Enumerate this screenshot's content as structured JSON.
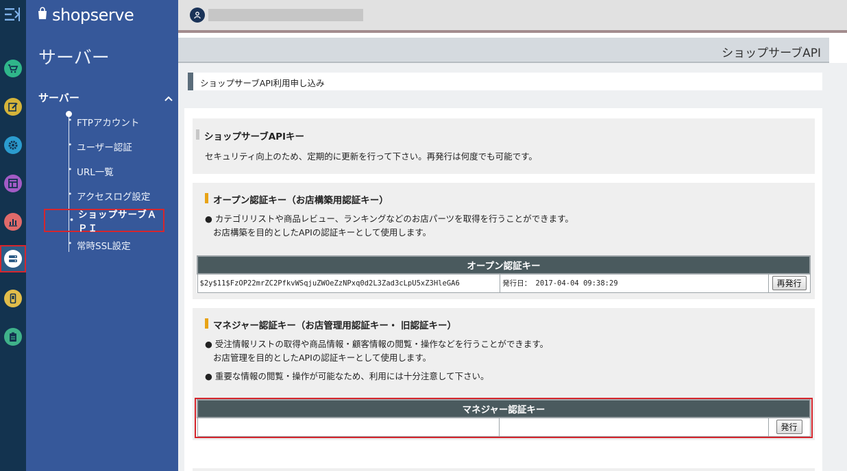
{
  "brand": {
    "name": "shopserve"
  },
  "rail": {
    "items": [
      {
        "name": "cart-icon",
        "color": "#2fb68a"
      },
      {
        "name": "edit-icon",
        "color": "#d5b43a"
      },
      {
        "name": "settings-icon",
        "color": "#2b9ccf"
      },
      {
        "name": "layout-icon",
        "color": "#a35bc6"
      },
      {
        "name": "chart-icon",
        "color": "#e06a6a"
      },
      {
        "name": "server-icon",
        "color": "#ffffff",
        "active": true
      },
      {
        "name": "mobile-icon",
        "color": "#e2bd4a"
      },
      {
        "name": "clipboard-icon",
        "color": "#3fb28a"
      }
    ]
  },
  "sidebar": {
    "title": "サーバー",
    "section": "サーバー",
    "items": [
      {
        "label": "FTPアカウント"
      },
      {
        "label": "ユーザー認証"
      },
      {
        "label": "URL一覧"
      },
      {
        "label": "アクセスログ設定"
      },
      {
        "label": "ショップサーブＡＰＩ",
        "active": true
      },
      {
        "label": "常時SSL設定"
      }
    ]
  },
  "header": {
    "user_name": ""
  },
  "page": {
    "title": "ショップサーブAPI",
    "breadcrumb": "ショップサーブAPI利用申し込み"
  },
  "api_key_panel": {
    "heading": "ショップサーブAPIキー",
    "description": "セキュリティ向上のため、定期的に更新を行って下さい。再発行は何度でも可能です。"
  },
  "open_key_panel": {
    "heading": "オープン認証キー（お店構築用認証キー）",
    "line1": "● カテゴリリストや商品レビュー、ランキングなどのお店パーツを取得を行うことができます。",
    "line2": "お店構築を目的としたAPIの認証キーとして使用します。",
    "table_header": "オープン認証キー",
    "key_value": "$2y$11$FzOP22mrZC2PfkvWSqjuZWOeZzNPxq0d2L3Zad3cLpU5xZ3HleGA6",
    "issued": "発行日： 2017-04-04 09:38:29",
    "button": "再発行"
  },
  "manager_key_panel": {
    "heading": "マネジャー認証キー（お店管理用認証キー・ 旧認証キー）",
    "line1": "● 受注情報リストの取得や商品情報・顧客情報の閲覧・操作などを行うことができます。",
    "line2": "お店管理を目的としたAPIの認証キーとして使用します。",
    "line3": "● 重要な情報の閲覧・操作が可能なため、利用には十分注意して下さい。",
    "table_header": "マネジャー認証キー",
    "key_value": "",
    "issued": "",
    "button": "発行"
  }
}
